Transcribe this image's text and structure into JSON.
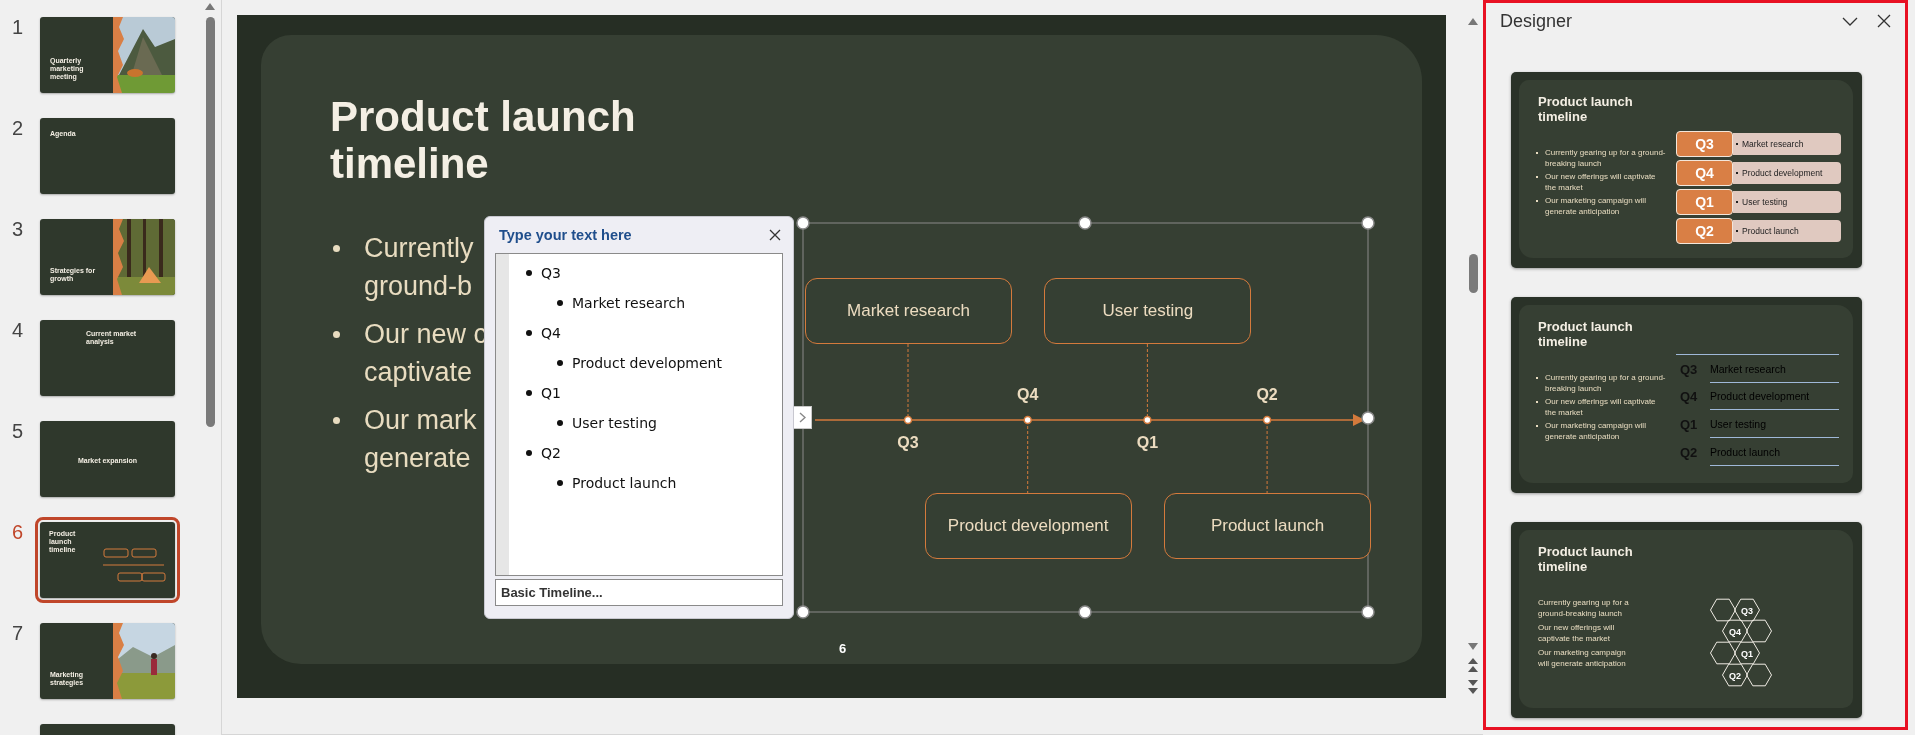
{
  "slide_panel": {
    "thumbnails": [
      {
        "number": "1",
        "title": "Quarterly marketing meeting",
        "selected": false
      },
      {
        "number": "2",
        "kind": "agenda",
        "title": "Agenda",
        "selected": false
      },
      {
        "number": "3",
        "title": "Strategies for growth",
        "selected": false
      },
      {
        "number": "4",
        "kind": "text",
        "title": "Current market analysis",
        "selected": false
      },
      {
        "number": "5",
        "kind": "section",
        "title": "Market expansion",
        "selected": false
      },
      {
        "number": "6",
        "kind": "timeline",
        "title": "Product launch timeline",
        "selected": true
      },
      {
        "number": "7",
        "title": "Marketing strategies",
        "selected": false
      },
      {
        "kind": "cut"
      }
    ]
  },
  "slide": {
    "title": "Product launch timeline",
    "bullets": [
      {
        "lines": [
          "Currently",
          "ground-b"
        ]
      },
      {
        "lines": [
          "Our new c",
          "captivate"
        ]
      },
      {
        "lines": [
          "Our mark",
          "generate"
        ]
      }
    ],
    "timeline": {
      "events": [
        {
          "label": "Q3",
          "text": "Market research",
          "kind": "above"
        },
        {
          "label": "Q4",
          "text": "Product development",
          "kind": "below"
        },
        {
          "label": "Q1",
          "text": "User testing",
          "kind": "above"
        },
        {
          "label": "Q2",
          "text": "Product launch",
          "kind": "below"
        }
      ]
    },
    "page_number": "6"
  },
  "text_pane": {
    "title": "Type your text here",
    "items": [
      {
        "text": "Q3",
        "children": [
          {
            "text": "Market research"
          }
        ]
      },
      {
        "text": "Q4",
        "children": [
          {
            "text": "Product development"
          }
        ]
      },
      {
        "text": "Q1",
        "children": [
          {
            "text": "User testing"
          }
        ]
      },
      {
        "text": "Q2",
        "children": [
          {
            "text": "Product launch"
          }
        ]
      }
    ],
    "footer": "Basic Timeline..."
  },
  "designer": {
    "title": "Designer",
    "designs": [
      {
        "kind": "boxes",
        "title": "Product launch timeline",
        "bullets": [
          "Currently gearing up for a ground-breaking launch",
          "Our new offerings will captivate the market",
          "Our marketing campaign will generate anticipation"
        ],
        "items": [
          {
            "label": "Q3",
            "text": "Market research"
          },
          {
            "label": "Q4",
            "text": "Product development"
          },
          {
            "label": "Q1",
            "text": "User testing"
          },
          {
            "label": "Q2",
            "text": "Product launch"
          }
        ]
      },
      {
        "kind": "lines",
        "title": "Product launch timeline",
        "bullets": [
          "Currently gearing up for a ground-breaking launch",
          "Our new offerings will captivate the market",
          "Our marketing campaign will generate anticipation"
        ],
        "items": [
          {
            "label": "Q3",
            "text": "Market research"
          },
          {
            "label": "Q4",
            "text": "Product development"
          },
          {
            "label": "Q1",
            "text": "User testing"
          },
          {
            "label": "Q2",
            "text": "Product launch"
          }
        ]
      },
      {
        "kind": "hexagons",
        "title": "Product launch timeline",
        "bullets": [
          "Currently gearing up for a ground-breaking launch",
          "Our new offerings will captivate the market",
          "Our marketing campaign will generate anticipation"
        ],
        "items": [
          {
            "label": "Q3"
          },
          {
            "label": "Q4"
          },
          {
            "label": "Q1"
          },
          {
            "label": "Q2"
          }
        ]
      }
    ]
  }
}
